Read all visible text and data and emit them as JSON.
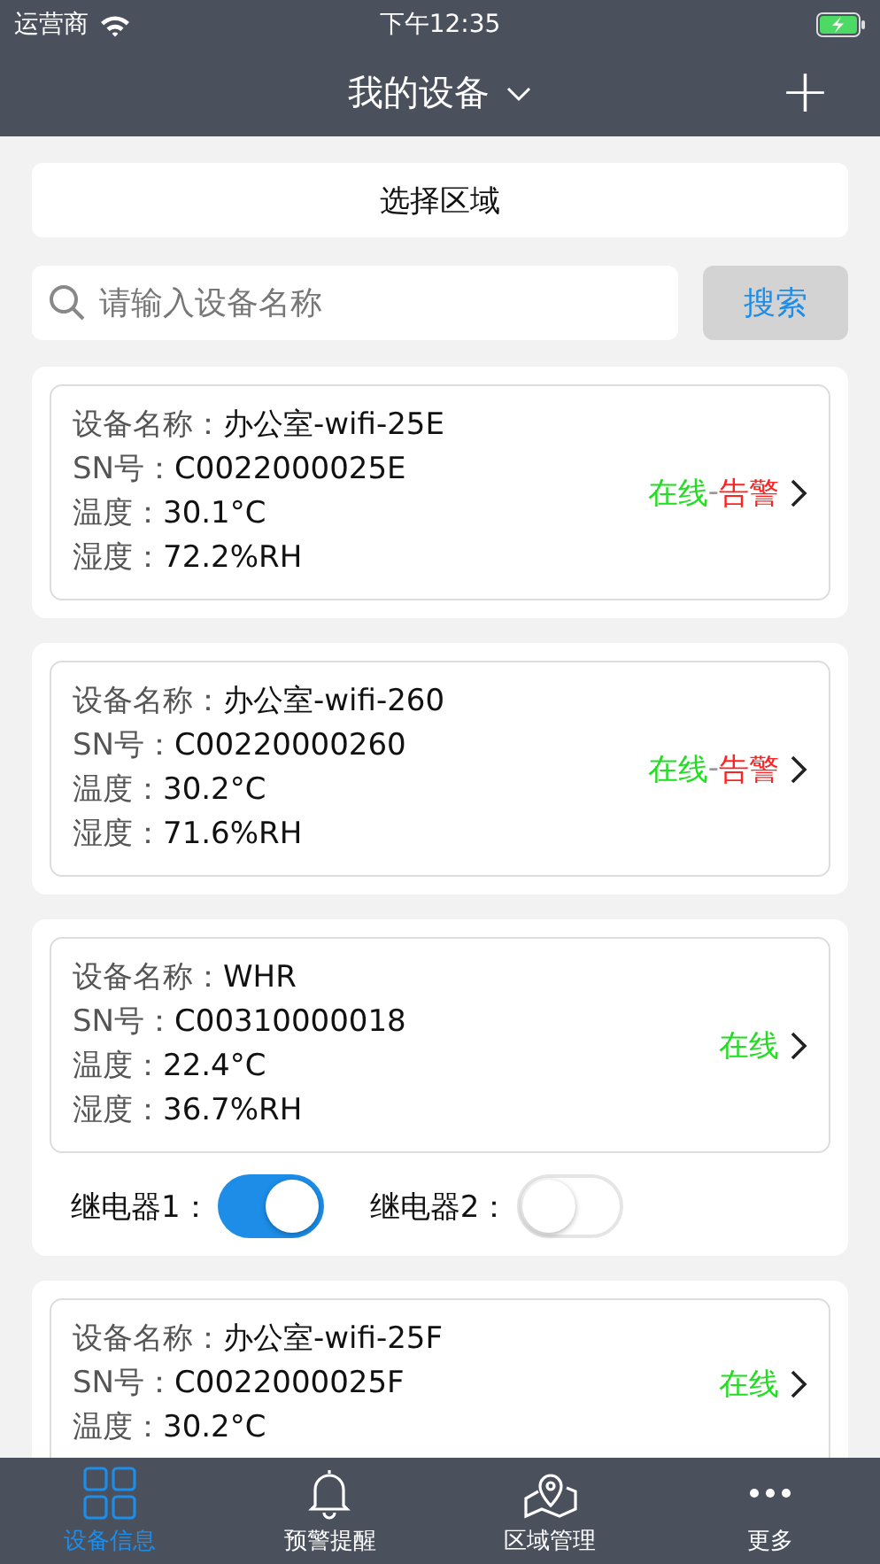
{
  "status_bar": {
    "carrier": "运营商",
    "time": "下午12:35"
  },
  "nav": {
    "title": "我的设备",
    "add": "+"
  },
  "region_button": "选择区域",
  "search": {
    "placeholder": "请输入设备名称",
    "button": "搜索"
  },
  "devices": [
    {
      "name_label": "设备名称：",
      "name": "办公室-wifi-25E",
      "sn_label": "SN号：",
      "sn": "C0022000025E",
      "temp_label": "温度：",
      "temp": "30.1°C",
      "hum_label": "湿度：",
      "hum": "72.2%RH",
      "status": [
        {
          "text": "在线",
          "color": "#22dd22"
        },
        {
          "text": "-",
          "color": "#999999"
        },
        {
          "text": "告警",
          "color": "#ff2222"
        }
      ]
    },
    {
      "name_label": "设备名称：",
      "name": "办公室-wifi-260",
      "sn_label": "SN号：",
      "sn": "C00220000260",
      "temp_label": "温度：",
      "temp": "30.2°C",
      "hum_label": "湿度：",
      "hum": "71.6%RH",
      "status": [
        {
          "text": "在线",
          "color": "#22dd22"
        },
        {
          "text": "-",
          "color": "#999999"
        },
        {
          "text": "告警",
          "color": "#ff2222"
        }
      ]
    },
    {
      "name_label": "设备名称：",
      "name": "WHR",
      "sn_label": "SN号：",
      "sn": "C00310000018",
      "temp_label": "温度：",
      "temp": "22.4°C",
      "hum_label": "湿度：",
      "hum": "36.7%RH",
      "status": [
        {
          "text": "在线",
          "color": "#22dd22"
        }
      ],
      "relays": [
        {
          "label": "继电器1：",
          "on": true
        },
        {
          "label": "继电器2：",
          "on": false
        }
      ]
    },
    {
      "name_label": "设备名称：",
      "name": "办公室-wifi-25F",
      "sn_label": "SN号：",
      "sn": "C0022000025F",
      "temp_label": "温度：",
      "temp": "30.2°C",
      "status": [
        {
          "text": "在线",
          "color": "#22dd22"
        }
      ]
    }
  ],
  "tabs": [
    {
      "label": "设备信息",
      "kind": "grid",
      "selected": true
    },
    {
      "label": "预警提醒",
      "kind": "bell",
      "selected": false
    },
    {
      "label": "区域管理",
      "kind": "map",
      "selected": false
    },
    {
      "label": "更多",
      "kind": "more",
      "selected": false
    }
  ]
}
